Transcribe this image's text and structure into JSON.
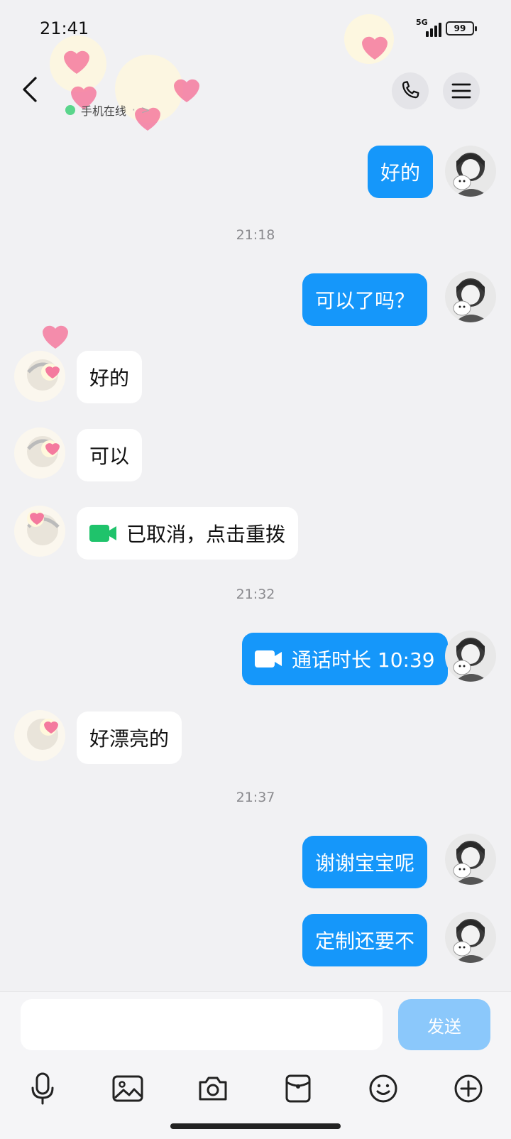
{
  "status_bar": {
    "time": "21:41",
    "network": "5G",
    "battery": "99"
  },
  "header": {
    "online_status": "手机在线",
    "online_suffix": "·",
    "chevron": ">"
  },
  "messages": {
    "m1": "好的",
    "t1": "21:18",
    "m2": "可以了吗？",
    "m3": "好的",
    "m4": "可以",
    "m5": "已取消，点击重拨",
    "t2": "21:32",
    "m6": "通话时长 10:39",
    "m7": "好漂亮的",
    "t3": "21:37",
    "m8": "谢谢宝宝呢",
    "m9": "定制还要不"
  },
  "composer": {
    "send_label": "发送",
    "placeholder": ""
  },
  "colors": {
    "self_bubble": "#1597fa",
    "other_bubble": "#ffffff",
    "send_button": "#8bc8fb",
    "background": "#f1f1f3",
    "video_icon_green": "#1fc36b",
    "online_dot": "#5ad58b"
  },
  "icons": [
    "back-icon",
    "phone-icon",
    "menu-icon",
    "video-camera-icon",
    "microphone-icon",
    "image-icon",
    "camera-icon",
    "red-packet-icon",
    "emoji-icon",
    "plus-icon"
  ]
}
